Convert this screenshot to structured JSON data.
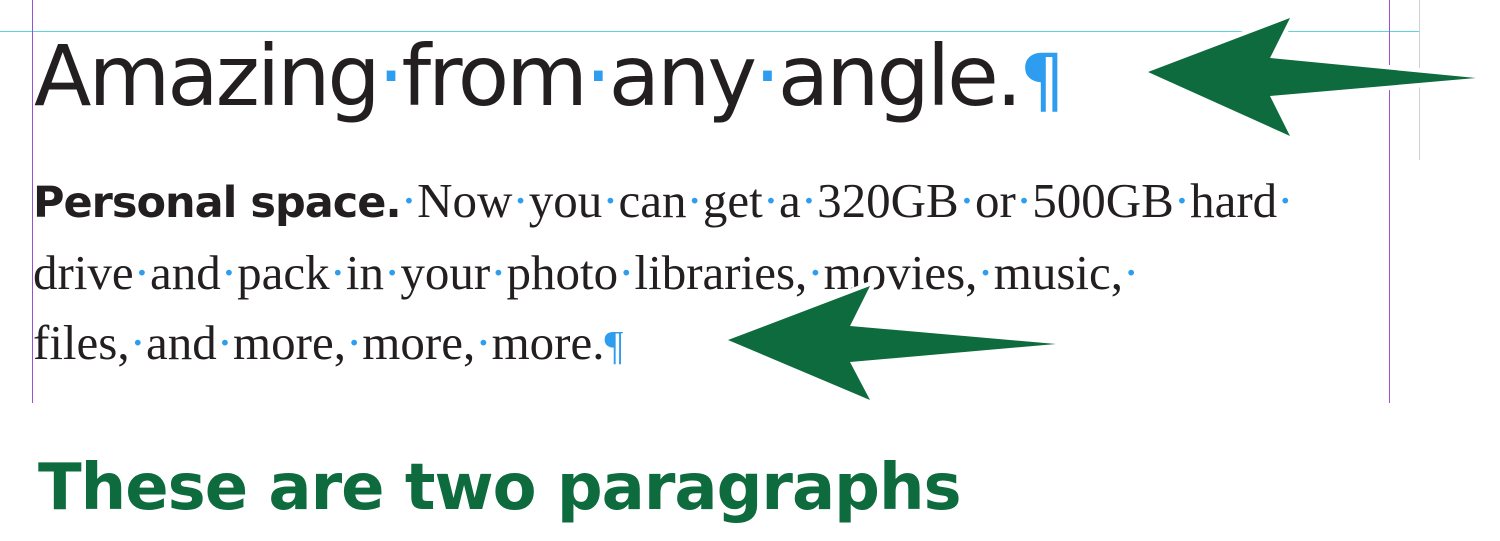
{
  "headline": {
    "words": [
      "Amazing",
      "from",
      "any",
      "angle."
    ],
    "space_marker": "·",
    "paragraph_marker": "¶"
  },
  "body": {
    "run_in": "Personal space.",
    "lines": [
      "Now·you·can·get·a·320GB·or·500GB·hard·",
      "drive·and·pack·in·your·photo·libraries,·movies,·music,·",
      "files,·and·more,·more,·more."
    ],
    "paragraph_marker": "¶"
  },
  "caption": {
    "text": "These are two paragraphs"
  },
  "colors": {
    "text": "#231f20",
    "invisible_marker": "#2e9df0",
    "arrow_fill": "#0d6b3e",
    "arrow_outline": "#ffffff",
    "guide_cyan": "#5fd3e6",
    "guide_purple": "#9b4fd6"
  },
  "icons": {
    "arrow_top": "left-arrow-icon",
    "arrow_bottom": "left-arrow-icon"
  }
}
